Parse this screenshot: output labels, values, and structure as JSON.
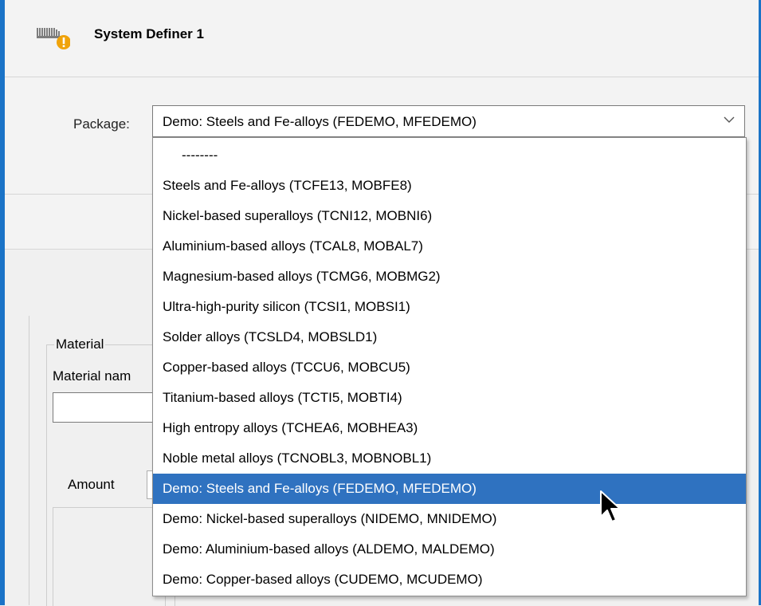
{
  "window": {
    "title": "System Definer 1"
  },
  "package": {
    "label": "Package:",
    "selected_value": "Demo: Steels and Fe-alloys (FEDEMO, MFEDEMO)",
    "options": [
      "--------",
      "Steels and Fe-alloys (TCFE13, MOBFE8)",
      "Nickel-based superalloys (TCNI12, MOBNI6)",
      "Aluminium-based alloys (TCAL8, MOBAL7)",
      "Magnesium-based alloys (TCMG6, MOBMG2)",
      "Ultra-high-purity silicon (TCSI1, MOBSI1)",
      "Solder alloys (TCSLD4, MOBSLD1)",
      "Copper-based alloys (TCCU6, MOBCU5)",
      "Titanium-based alloys (TCTI5, MOBTI4)",
      "High entropy alloys (TCHEA6, MOBHEA3)",
      "Noble metal alloys (TCNOBL3, MOBNOBL1)",
      "Demo: Steels and Fe-alloys (FEDEMO, MFEDEMO)",
      "Demo: Nickel-based superalloys (NIDEMO, MNIDEMO)",
      "Demo: Aluminium-based alloys (ALDEMO, MALDEMO)",
      "Demo: Copper-based alloys (CUDEMO, MCUDEMO)"
    ],
    "selected_index": 11
  },
  "material": {
    "group_label": "Material",
    "name_label": "Material nam",
    "name_value": ""
  },
  "amount": {
    "label": "Amount"
  },
  "colors": {
    "accent": "#1a73c7",
    "selection": "#2f72c0",
    "warning": "#f0a30a"
  },
  "icons": {
    "header": "system-definer-warning-icon",
    "select": "chevron-down-icon",
    "cursor": "mouse-pointer-icon"
  }
}
